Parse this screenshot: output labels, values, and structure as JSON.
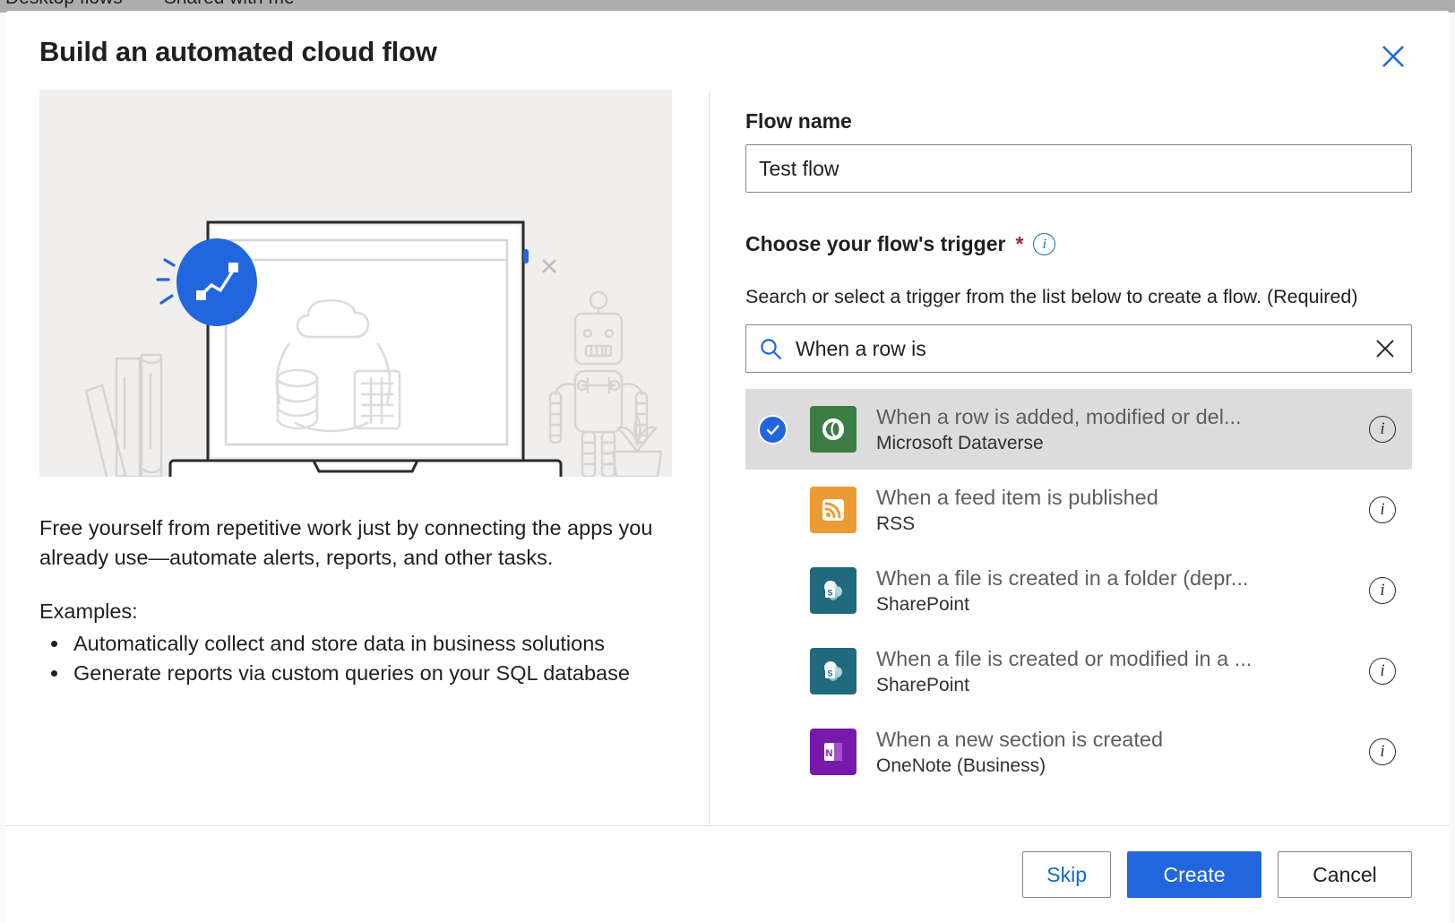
{
  "background": {
    "tabs": [
      "Desktop flows",
      "Shared with me"
    ]
  },
  "dialog": {
    "title": "Build an automated cloud flow",
    "close_icon": "close-icon"
  },
  "left": {
    "illustration_name": "automated-cloud-flow-illustration",
    "blurb": "Free yourself from repetitive work just by connecting the apps you already use—automate alerts, reports, and other tasks.",
    "examples_label": "Examples:",
    "examples": [
      "Automatically collect and store data in business solutions",
      "Generate reports via custom queries on your SQL database"
    ]
  },
  "right": {
    "flow_name": {
      "label": "Flow name",
      "value": "Test flow",
      "placeholder": "Flow name"
    },
    "trigger": {
      "label": "Choose your flow's trigger",
      "required_marker": "*",
      "info_glyph": "i",
      "helper_text": "Search or select a trigger from the list below to create a flow. (Required)",
      "search": {
        "value": "When a row is",
        "placeholder": "Search",
        "search_icon": "search-icon",
        "clear_icon": "clear-icon"
      },
      "items": [
        {
          "title": "When a row is added, modified or del...",
          "subtitle": "Microsoft Dataverse",
          "icon": "dataverse-icon",
          "icon_color": "#3b7d44",
          "selected": true
        },
        {
          "title": "When a feed item is published",
          "subtitle": "RSS",
          "icon": "rss-icon",
          "icon_color": "#eb9b34",
          "selected": false
        },
        {
          "title": "When a file is created in a folder (depr...",
          "subtitle": "SharePoint",
          "icon": "sharepoint-icon",
          "icon_color": "#21697c",
          "selected": false
        },
        {
          "title": "When a file is created or modified in a ...",
          "subtitle": "SharePoint",
          "icon": "sharepoint-icon",
          "icon_color": "#21697c",
          "selected": false
        },
        {
          "title": "When a new section is created",
          "subtitle": "OneNote (Business)",
          "icon": "onenote-icon",
          "icon_color": "#7719aa",
          "selected": false
        }
      ]
    }
  },
  "footer": {
    "skip_label": "Skip",
    "create_label": "Create",
    "cancel_label": "Cancel"
  },
  "colors": {
    "accent_blue": "#2266dd",
    "link_blue": "#0f6cbd",
    "required_red": "#a4262c",
    "selected_row_bg": "#dcdcdc",
    "illustration_bg": "#f1efee"
  }
}
